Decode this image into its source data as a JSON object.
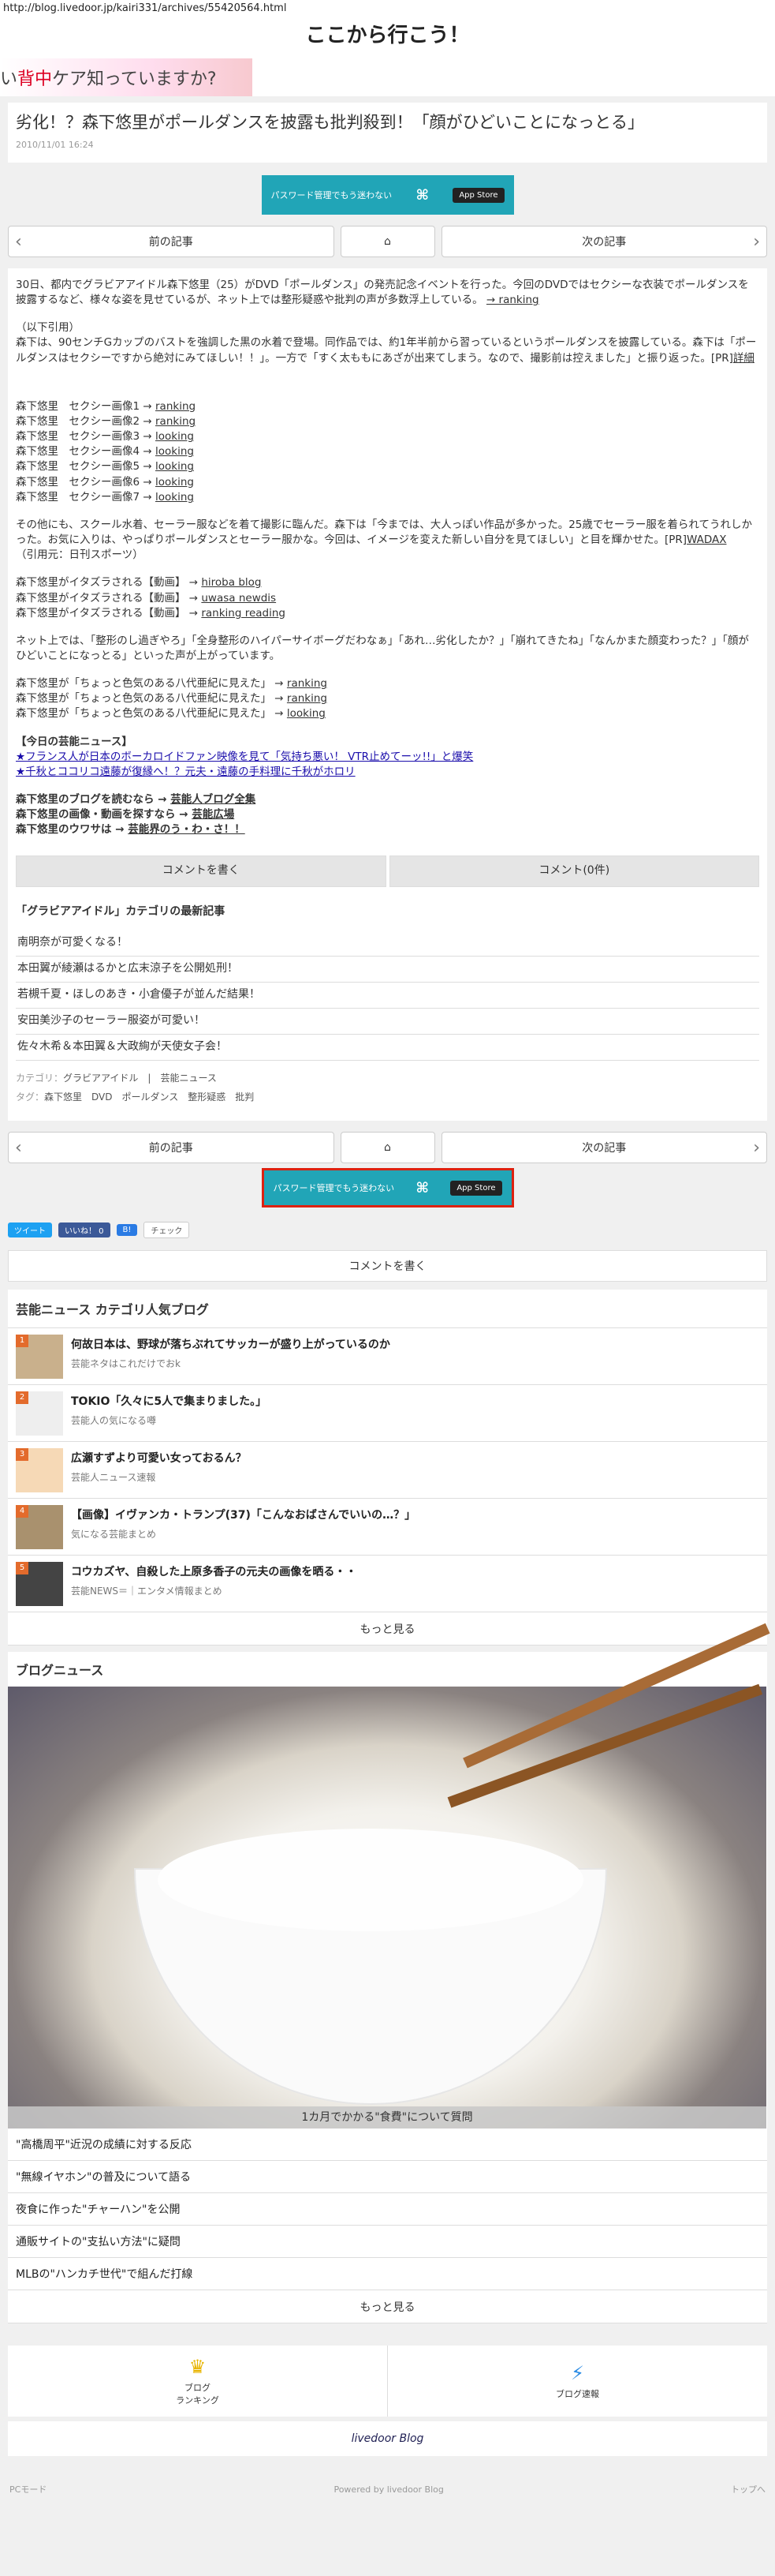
{
  "url": "http://blog.livedoor.jp/kairi331/archives/55420564.html",
  "site_title": "ここから行こう！",
  "banner": {
    "text_pre": "い",
    "text_hl": "背中",
    "text_post": "ケア知っていますか?"
  },
  "article": {
    "title": "劣化！？森下悠里がポールダンスを披露も批判殺到！「顔がひどいことになっとる」",
    "date": "2010/11/01 16:24"
  },
  "ad": {
    "text": "パスワード管理でもう迷わない",
    "store": "App Store"
  },
  "nav": {
    "prev": "前の記事",
    "next": "次の記事"
  },
  "body": {
    "intro": "30日、都内でグラビアアイドル森下悠里（25）がDVD「ポールダンス」の発売記念イベントを行った。今回のDVDではセクシーな衣装でポールダンスを披露するなど、様々な姿を見せているが、ネット上では整形疑惑や批判の声が多数浮上している。",
    "intro_link": "→ ranking",
    "quote_head": "（以下引用）",
    "quote": "森下は、90センチGカップのバストを強調した黒の水着で登場。同作品では、約1年半前から習っているというポールダンスを披露している。森下は「ポールダンスはセクシーですから絶対にみてほしい！！」。一方で「すく太ももにあざが出来てしまう。なので、撮影前は控えました」と振り返った。[PR]",
    "quote_link": "詳細",
    "images": [
      {
        "label": "森下悠里　セクシー画像1 →",
        "link": "ranking"
      },
      {
        "label": "森下悠里　セクシー画像2 →",
        "link": "ranking"
      },
      {
        "label": "森下悠里　セクシー画像3 →",
        "link": "looking"
      },
      {
        "label": "森下悠里　セクシー画像4 →",
        "link": "looking"
      },
      {
        "label": "森下悠里　セクシー画像5 →",
        "link": "looking"
      },
      {
        "label": "森下悠里　セクシー画像6 →",
        "link": "looking"
      },
      {
        "label": "森下悠里　セクシー画像7 →",
        "link": "looking"
      }
    ],
    "other": "その他にも、スクール水着、セーラー服などを着て撮影に臨んだ。森下は「今までは、大人っぽい作品が多かった。25歳でセーラー服を着られてうれしかった。お気に入りは、やっぱりポールダンスとセーラー服かな。今回は、イメージを変えた新しい自分を見てほしい」と目を輝かせた。[PR]",
    "other_link": "WADAX",
    "source": "（引用元：日刊スポーツ）",
    "videos": [
      {
        "label": "森下悠里がイタズラされる【動画】 →",
        "link": "hiroba blog"
      },
      {
        "label": "森下悠里がイタズラされる【動画】 →",
        "link": "uwasa newdis"
      },
      {
        "label": "森下悠里がイタズラされる【動画】 →",
        "link": "ranking reading"
      }
    ],
    "net": "ネット上では、「整形のし過ぎやろ」「全身整形のハイパーサイボーグだわなぁ」「あれ…劣化したか？」「崩れてきたね」「なんかまた顔変わった？」「顔がひどいことになっとる」といった声が上がっています。",
    "net_items": [
      {
        "label": "森下悠里が「ちょっと色気のある八代亜紀に見えた」 →",
        "link": "ranking"
      },
      {
        "label": "森下悠里が「ちょっと色気のある八代亜紀に見えた」 →",
        "link": "ranking"
      },
      {
        "label": "森下悠里が「ちょっと色気のある八代亜紀に見えた」 →",
        "link": "looking"
      }
    ],
    "today_head": "【今日の芸能ニュース】",
    "today": [
      "★フランス人が日本のボーカロイドファン映像を見て「気持ち悪い！ VTR止めてーッ!!」と爆笑",
      "★千秋とココリコ遠藤が復縁へ！？元夫・遠藤の手料理に千秋がホロリ"
    ],
    "more": [
      {
        "label": "森下悠里のブログを読むなら →",
        "link": "芸能人ブログ全集"
      },
      {
        "label": "森下悠里の画像・動画を探すなら →",
        "link": "芸能広場"
      },
      {
        "label": "森下悠里のウワサは →",
        "link": "芸能界のう・わ・さ！！"
      }
    ],
    "comment_write": "コメントを書く",
    "comment_count": "コメント(0件)",
    "cat_title": "「グラビアアイドル」カテゴリの最新記事",
    "cat_list": [
      "南明奈が可愛くなる！",
      "本田翼が綾瀬はるかと広末涼子を公開処刑！",
      "若槻千夏・ほしのあき・小倉優子が並んだ結果！",
      "安田美沙子のセーラー服姿が可愛い！",
      "佐々木希＆本田翼＆大政絢が天使女子会！"
    ],
    "meta_cat_label": "カテゴリ：",
    "meta_cat": "グラビアアイドル　|　芸能ニュース",
    "meta_tag_label": "タグ：",
    "meta_tags": "森下悠里　DVD　ポールダンス　整形疑惑　批判"
  },
  "share": {
    "tweet": "ツイート",
    "like": "いいね！ 0",
    "b": "B!",
    "check": "チェック"
  },
  "comment_write": "コメントを書く",
  "rank": {
    "title": "芸能ニュース カテゴリ人気ブログ",
    "items": [
      {
        "n": "1",
        "title": "何故日本は、野球が落ちぶれてサッカーが盛り上がっているのか",
        "sub": "芸能ネタはこれだけでおk"
      },
      {
        "n": "2",
        "title": "TOKIO「久々に5人で集まりました。」",
        "sub": "芸能人の気になる噂"
      },
      {
        "n": "3",
        "title": "広瀬すずより可愛い女っておるん？",
        "sub": "芸能人ニュース速報"
      },
      {
        "n": "4",
        "title": "【画像】イヴァンカ・トランプ(37)「こんなおばさんでいいの…？」",
        "sub": "気になる芸能まとめ"
      },
      {
        "n": "5",
        "title": "コウカズヤ、自殺した上原多香子の元夫の画像を晒る・・",
        "sub": "芸能NEWS＝｜エンタメ情報まとめ"
      }
    ],
    "more": "もっと見る"
  },
  "news": {
    "title": "ブログニュース",
    "caption": "1カ月でかかる\"食費\"について質問",
    "items": [
      "\"高橋周平\"近況の成績に対する反応",
      "\"無線イヤホン\"の普及について語る",
      "夜食に作った\"チャーハン\"を公開",
      "通販サイトの\"支払い方法\"に疑問",
      "MLBの\"ハンカチ世代\"で組んだ打線"
    ],
    "more": "もっと見る"
  },
  "footer": {
    "ranking": "ブログ\nランキング",
    "news": "ブログ速報",
    "logo": "livedoor Blog",
    "pc": "PCモード",
    "powered": "Powered by livedoor Blog",
    "top": "トップへ"
  }
}
